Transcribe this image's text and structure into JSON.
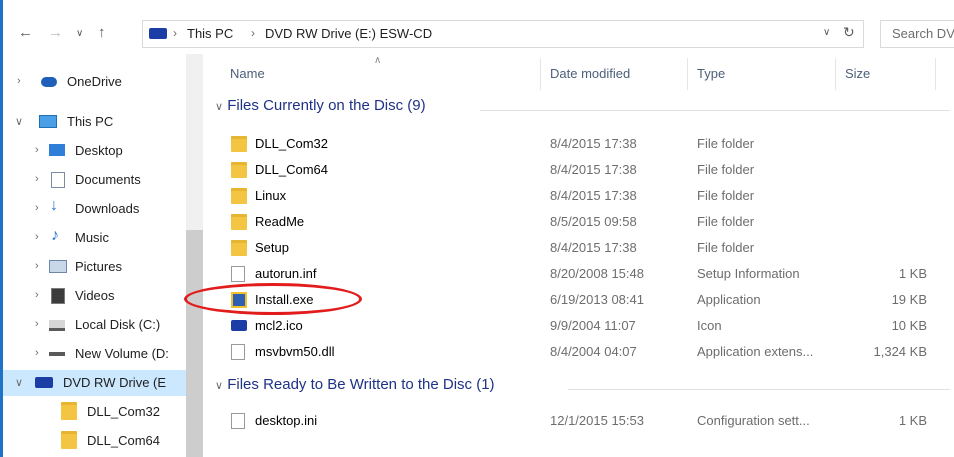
{
  "address": {
    "crumbs": [
      "This PC",
      "DVD RW Drive (E:) ESW-CD"
    ],
    "search_placeholder": "Search DV"
  },
  "nav": {
    "items": [
      {
        "label": "OneDrive",
        "icon": "cloud-icon"
      },
      {
        "label": "This PC",
        "icon": "computer-icon"
      },
      {
        "label": "Desktop",
        "icon": "desktop-icon"
      },
      {
        "label": "Documents",
        "icon": "documents-icon"
      },
      {
        "label": "Downloads",
        "icon": "downloads-icon"
      },
      {
        "label": "Music",
        "icon": "music-icon"
      },
      {
        "label": "Pictures",
        "icon": "pictures-icon"
      },
      {
        "label": "Videos",
        "icon": "videos-icon"
      },
      {
        "label": "Local Disk (C:)",
        "icon": "disk-icon"
      },
      {
        "label": "New Volume (D:",
        "icon": "disk-icon"
      },
      {
        "label": "DVD RW Drive (E",
        "icon": "dvd-drive-icon"
      },
      {
        "label": "DLL_Com32",
        "icon": "folder-icon"
      },
      {
        "label": "DLL_Com64",
        "icon": "folder-icon"
      }
    ]
  },
  "columns": {
    "name": "Name",
    "date": "Date modified",
    "type": "Type",
    "size": "Size"
  },
  "groups": [
    {
      "title": "Files Currently on the Disc (9)",
      "rows": [
        {
          "name": "DLL_Com32",
          "date": "8/4/2015 17:38",
          "type": "File folder",
          "size": "",
          "icon": "folder-icon"
        },
        {
          "name": "DLL_Com64",
          "date": "8/4/2015 17:38",
          "type": "File folder",
          "size": "",
          "icon": "folder-icon"
        },
        {
          "name": "Linux",
          "date": "8/4/2015 17:38",
          "type": "File folder",
          "size": "",
          "icon": "folder-icon"
        },
        {
          "name": "ReadMe",
          "date": "8/5/2015 09:58",
          "type": "File folder",
          "size": "",
          "icon": "folder-icon"
        },
        {
          "name": "Setup",
          "date": "8/4/2015 17:38",
          "type": "File folder",
          "size": "",
          "icon": "folder-icon"
        },
        {
          "name": "autorun.inf",
          "date": "8/20/2008 15:48",
          "type": "Setup Information",
          "size": "1 KB",
          "icon": "setup-file-icon"
        },
        {
          "name": "Install.exe",
          "date": "6/19/2013 08:41",
          "type": "Application",
          "size": "19 KB",
          "icon": "installer-icon"
        },
        {
          "name": "mcl2.ico",
          "date": "9/9/2004 11:07",
          "type": "Icon",
          "size": "10 KB",
          "icon": "drive-image-icon"
        },
        {
          "name": "msvbvm50.dll",
          "date": "8/4/2004 04:07",
          "type": "Application extens...",
          "size": "1,324 KB",
          "icon": "dll-icon"
        }
      ]
    },
    {
      "title": "Files Ready to Be Written to the Disc (1)",
      "rows": [
        {
          "name": "desktop.ini",
          "date": "12/1/2015 15:53",
          "type": "Configuration sett...",
          "size": "1 KB",
          "icon": "config-file-icon"
        }
      ]
    }
  ],
  "colors": {
    "selection": "#cce8ff",
    "group_header": "#1e3287",
    "highlight_ellipse": "#e21b1b"
  }
}
